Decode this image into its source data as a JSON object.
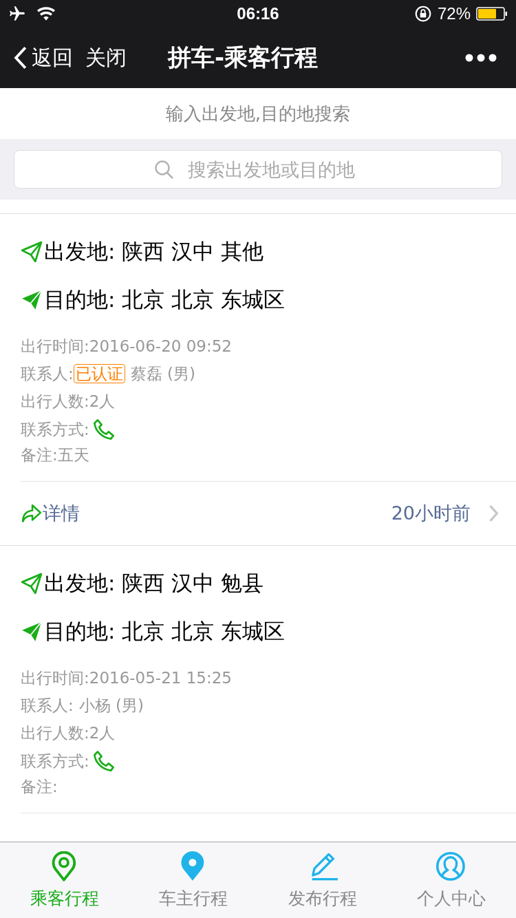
{
  "status_bar": {
    "time": "06:16",
    "battery": "72%"
  },
  "nav": {
    "back": "返回",
    "close": "关闭",
    "title": "拼车-乘客行程"
  },
  "search": {
    "hint": "输入出发地,目的地搜索",
    "placeholder": "搜索出发地或目的地"
  },
  "trips": [
    {
      "from": "出发地: 陕西 汉中 其他",
      "to": "目的地: 北京 北京 东城区",
      "time": "出行时间:2016-06-20 09:52",
      "contact_label": "联系人:",
      "verified": true,
      "verified_label": "已认证",
      "contact_name": "蔡磊 (男)",
      "count": "出行人数:2人",
      "method_label": "联系方式:",
      "note": "备注:五天",
      "detail": "详情",
      "ago": "20小时前"
    },
    {
      "from": "出发地: 陕西 汉中 勉县",
      "to": "目的地: 北京 北京 东城区",
      "time": "出行时间:2016-05-21 15:25",
      "contact_label": "联系人:",
      "verified": false,
      "contact_name": "小杨 (男)",
      "count": "出行人数:2人",
      "method_label": "联系方式:",
      "note": "备注:"
    }
  ],
  "tabs": [
    {
      "label": "乘客行程",
      "kind": "pin-outline",
      "selected": true
    },
    {
      "label": "车主行程",
      "kind": "pin",
      "selected": false
    },
    {
      "label": "发布行程",
      "kind": "pencil",
      "selected": false
    },
    {
      "label": "个人中心",
      "kind": "person",
      "selected": false
    }
  ]
}
